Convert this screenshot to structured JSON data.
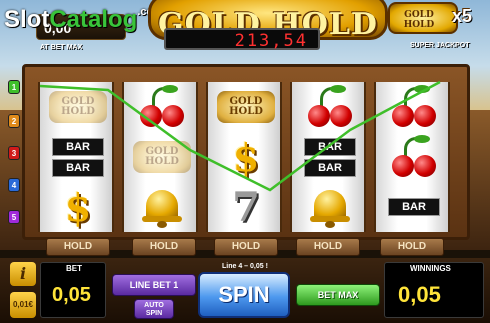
{
  "watermark": {
    "part1": "Slot",
    "part2": "Catalog",
    "domain": ".com"
  },
  "header": {
    "left_jackpot_value": "0,00",
    "left_jackpot_label": "AT BET MAX",
    "logo_text": "GOLD HOLD",
    "jackpot_digits": "213,54",
    "right_logo_text": "GOLD HOLD",
    "right_multiplier": "x5",
    "super_jackpot_label": "SUPER JACKPOT"
  },
  "line_markers": [
    "1",
    "2",
    "3",
    "4",
    "5"
  ],
  "reels": [
    [
      "gold-hold-faded",
      "bar-bar",
      "dollar"
    ],
    [
      "cherry",
      "gold-hold-faded",
      "bell"
    ],
    [
      "gold-hold",
      "dollar",
      "seven"
    ],
    [
      "cherry",
      "bar-bar",
      "bell"
    ],
    [
      "cherry",
      "cherry",
      "bar"
    ]
  ],
  "symbols": {
    "bar_label": "BAR",
    "gold_label_1": "GOLD",
    "gold_label_2": "HOLD",
    "dollar": "$",
    "seven": "7"
  },
  "hold_label": "HOLD",
  "controls": {
    "info_label": "i",
    "coin_label": "0,01€",
    "bet_label": "BET",
    "bet_value": "0,05",
    "line_bet_label": "LINE BET 1",
    "auto_spin_label_1": "AUTO",
    "auto_spin_label_2": "SPIN",
    "line_info": "Line 4 – 0,05 !",
    "spin_label": "SPIN",
    "bet_max_label": "BET MAX",
    "winnings_label": "WINNINGS",
    "winnings_value": "0,05"
  },
  "colors": {
    "win_line": "#3fbf2a",
    "digits": "#ff3030",
    "value_yellow": "#ffe43a"
  }
}
